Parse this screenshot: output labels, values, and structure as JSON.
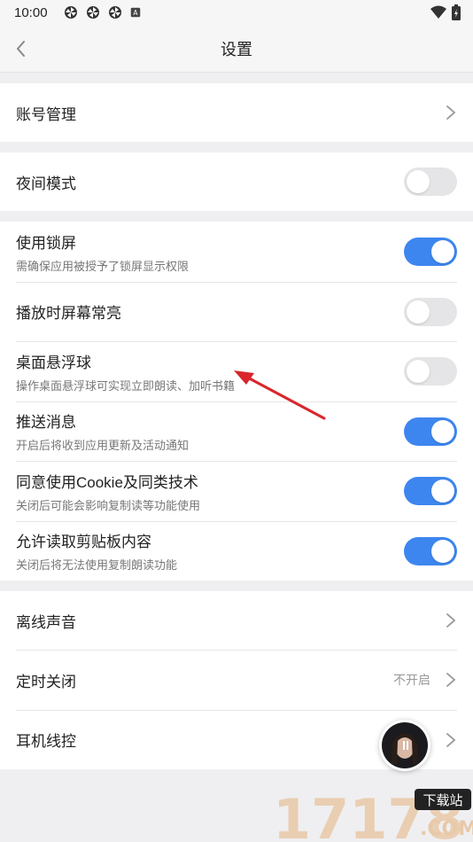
{
  "status_bar": {
    "time": "10:00",
    "notification_icons": [
      "pinwheel-icon",
      "pinwheel-icon",
      "pinwheel-icon",
      "a-badge-icon"
    ],
    "right_icons": [
      "wifi-icon",
      "battery-charging-icon"
    ]
  },
  "header": {
    "title": "设置"
  },
  "sections": {
    "account": {
      "label": "账号管理"
    },
    "night": {
      "label": "夜间模式",
      "toggle": "off"
    },
    "lockscreen": {
      "label": "使用锁屏",
      "sub": "需确保应用被授予了锁屏显示权限",
      "toggle": "on"
    },
    "screen_on": {
      "label": "播放时屏幕常亮",
      "toggle": "off"
    },
    "float_ball": {
      "label": "桌面悬浮球",
      "sub": "操作桌面悬浮球可实现立即朗读、加听书籍",
      "toggle": "off"
    },
    "push": {
      "label": "推送消息",
      "sub": "开启后将收到应用更新及活动通知",
      "toggle": "on"
    },
    "cookie": {
      "label": "同意使用Cookie及同类技术",
      "sub": "关闭后可能会影响复制读等功能使用",
      "toggle": "on"
    },
    "clipboard": {
      "label": "允许读取剪贴板内容",
      "sub": "关闭后将无法使用复制朗读功能",
      "toggle": "on"
    },
    "offline_voice": {
      "label": "离线声音"
    },
    "timer": {
      "label": "定时关闭",
      "value": "不开启"
    },
    "headset": {
      "label": "耳机线控"
    }
  },
  "watermark": {
    "brand": "17178",
    "tag": "下载站",
    "suffix": ".COM"
  },
  "colors": {
    "accent": "#3d86ef",
    "annotation_arrow": "#d9262b",
    "watermark": "#e8c9a8"
  }
}
